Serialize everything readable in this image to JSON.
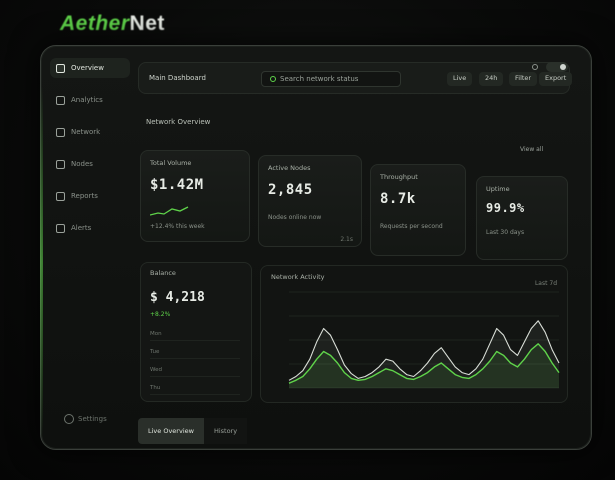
{
  "brand": {
    "part1": "Aether",
    "part2": "Net"
  },
  "sidebar": {
    "items": [
      {
        "label": "Overview",
        "active": true
      },
      {
        "label": "Analytics",
        "active": false
      },
      {
        "label": "Network",
        "active": false
      },
      {
        "label": "Nodes",
        "active": false
      },
      {
        "label": "Reports",
        "active": false
      },
      {
        "label": "Alerts",
        "active": false
      }
    ],
    "settings_label": "Settings"
  },
  "topbar": {
    "title": "Main Dashboard",
    "search_text": "Search network status",
    "buttons": [
      "Live",
      "24h",
      "Filter",
      "Export"
    ]
  },
  "section": {
    "title": "Network Overview",
    "link": "View all"
  },
  "cards": [
    {
      "label": "Total Volume",
      "value": "$1.42M",
      "sub": "+12.4% this week",
      "meta": ""
    },
    {
      "label": "Active Nodes",
      "value": "2,845",
      "sub": "Nodes online now",
      "meta": "2.1s"
    },
    {
      "label": "Throughput",
      "value": "8.7k",
      "sub": "Requests per second",
      "meta": ""
    },
    {
      "label": "Uptime",
      "value": "99.9%",
      "sub": "Last 30 days",
      "meta": ""
    }
  ],
  "balance": {
    "label": "Balance",
    "value": "$ 4,218",
    "change": "+8.2%",
    "rows": [
      "Mon",
      "Tue",
      "Wed",
      "Thu"
    ]
  },
  "activity": {
    "label": "Network Activity",
    "range": "Last 7d"
  },
  "tabs": [
    "Live Overview",
    "History"
  ],
  "colors": {
    "accent": "#5fd34a",
    "bg": "#0a0b0a",
    "panel": "#161916"
  },
  "chart_data": {
    "type": "line",
    "title": "Network Activity",
    "xlabel": "",
    "ylabel": "",
    "x": [
      0,
      1,
      2,
      3,
      4,
      5,
      6,
      7,
      8,
      9,
      10,
      11,
      12,
      13,
      14,
      15,
      16,
      17,
      18,
      19,
      20,
      21,
      22,
      23,
      24,
      25,
      26,
      27,
      28,
      29,
      30,
      31,
      32,
      33,
      34,
      35,
      36,
      37,
      38,
      39
    ],
    "ylim": [
      0,
      100
    ],
    "series": [
      {
        "values": [
          8,
          12,
          18,
          30,
          48,
          62,
          55,
          40,
          24,
          15,
          10,
          12,
          16,
          22,
          30,
          28,
          20,
          14,
          12,
          18,
          26,
          36,
          42,
          32,
          22,
          16,
          14,
          20,
          30,
          46,
          62,
          55,
          40,
          34,
          48,
          62,
          70,
          58,
          40,
          26
        ]
      },
      {
        "values": [
          5,
          8,
          12,
          20,
          30,
          38,
          34,
          26,
          16,
          10,
          8,
          9,
          12,
          16,
          20,
          18,
          14,
          10,
          9,
          12,
          16,
          22,
          26,
          20,
          14,
          11,
          10,
          14,
          20,
          28,
          38,
          34,
          26,
          22,
          30,
          40,
          46,
          38,
          26,
          16
        ]
      }
    ]
  }
}
